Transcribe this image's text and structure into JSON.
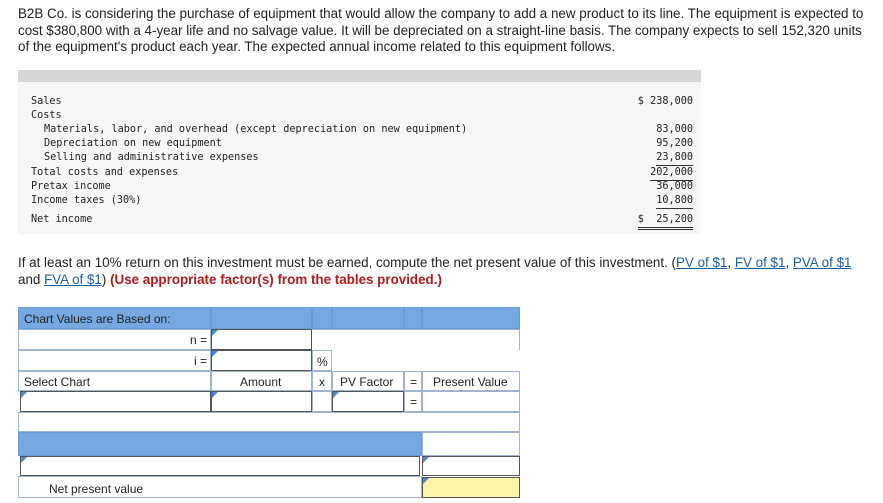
{
  "intro": "B2B Co. is considering the purchase of equipment that would allow the company to add a new product to its line. The equipment is expected to cost $380,800 with a 4-year life and no salvage value. It will be depreciated on a straight-line basis. The company expects to sell 152,320 units of the equipment's product each year. The expected annual income related to this equipment follows.",
  "income": {
    "sales_label": "Sales",
    "sales_value": "$ 238,000",
    "costs_label": "Costs",
    "materials_label": "Materials, labor, and overhead (except depreciation on new equipment)",
    "materials_value": "83,000",
    "depreciation_label": "Depreciation on new equipment",
    "depreciation_value": "95,200",
    "selling_label": "Selling and administrative expenses",
    "selling_value": "23,800",
    "total_label": "Total costs and expenses",
    "total_value": "202,000",
    "pretax_label": "Pretax income",
    "pretax_value": "36,000",
    "taxes_label": "Income taxes (30%)",
    "taxes_value": "10,800",
    "net_label": "Net income",
    "net_value": "$  25,200"
  },
  "question": {
    "text": "If at least an 10% return on this investment must be earned, compute the net present value of this investment.",
    "links": [
      "PV of $1",
      "FV of $1",
      "PVA of $1",
      "FVA of $1"
    ],
    "instruction": "(Use appropriate factor(s) from the tables provided.)"
  },
  "npv_table": {
    "chart_values_header": "Chart Values are Based on:",
    "n_label": "n =",
    "i_label": "i =",
    "percent_sign": "%",
    "select_chart_header": "Select Chart",
    "amount_header": "Amount",
    "times_symbol": "x",
    "pv_factor_header": "PV Factor",
    "equals_symbol": "=",
    "present_value_header": "Present Value",
    "net_present_value_label": "Net present value"
  }
}
